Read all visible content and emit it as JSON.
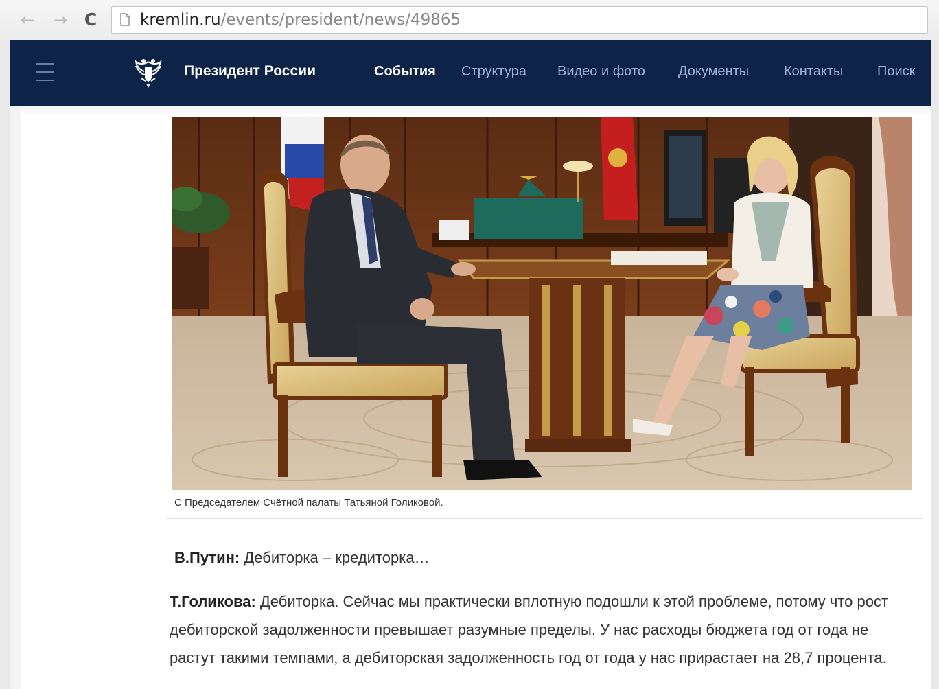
{
  "browser": {
    "url_host": "kremlin.ru",
    "url_path": "/events/president/news/49865"
  },
  "header": {
    "site_title": "Президент России",
    "menu": [
      "События",
      "Структура",
      "Видео и фото",
      "Документы",
      "Контакты",
      "Поиск"
    ],
    "active_index": 0
  },
  "article": {
    "caption": "С Председателем Счётной палаты Татьяной Голиковой.",
    "paragraphs": [
      {
        "speaker": "В.Путин:",
        "text": " Дебиторка – кредиторка…"
      },
      {
        "speaker": "Т.Голикова:",
        "text": " Дебиторка. Сейчас мы практически вплотную подошли к этой проблеме, потому что рост дебиторской задолженности превышает разумные пределы. У нас расходы бюджета год от года не растут такими темпами, а дебиторская задолженность год от года у нас прирастает на 28,7 процента."
      }
    ]
  },
  "colors": {
    "header_bg": "#0d2348",
    "menu_active": "#ffffff",
    "menu_inactive": "#9db3d6"
  }
}
